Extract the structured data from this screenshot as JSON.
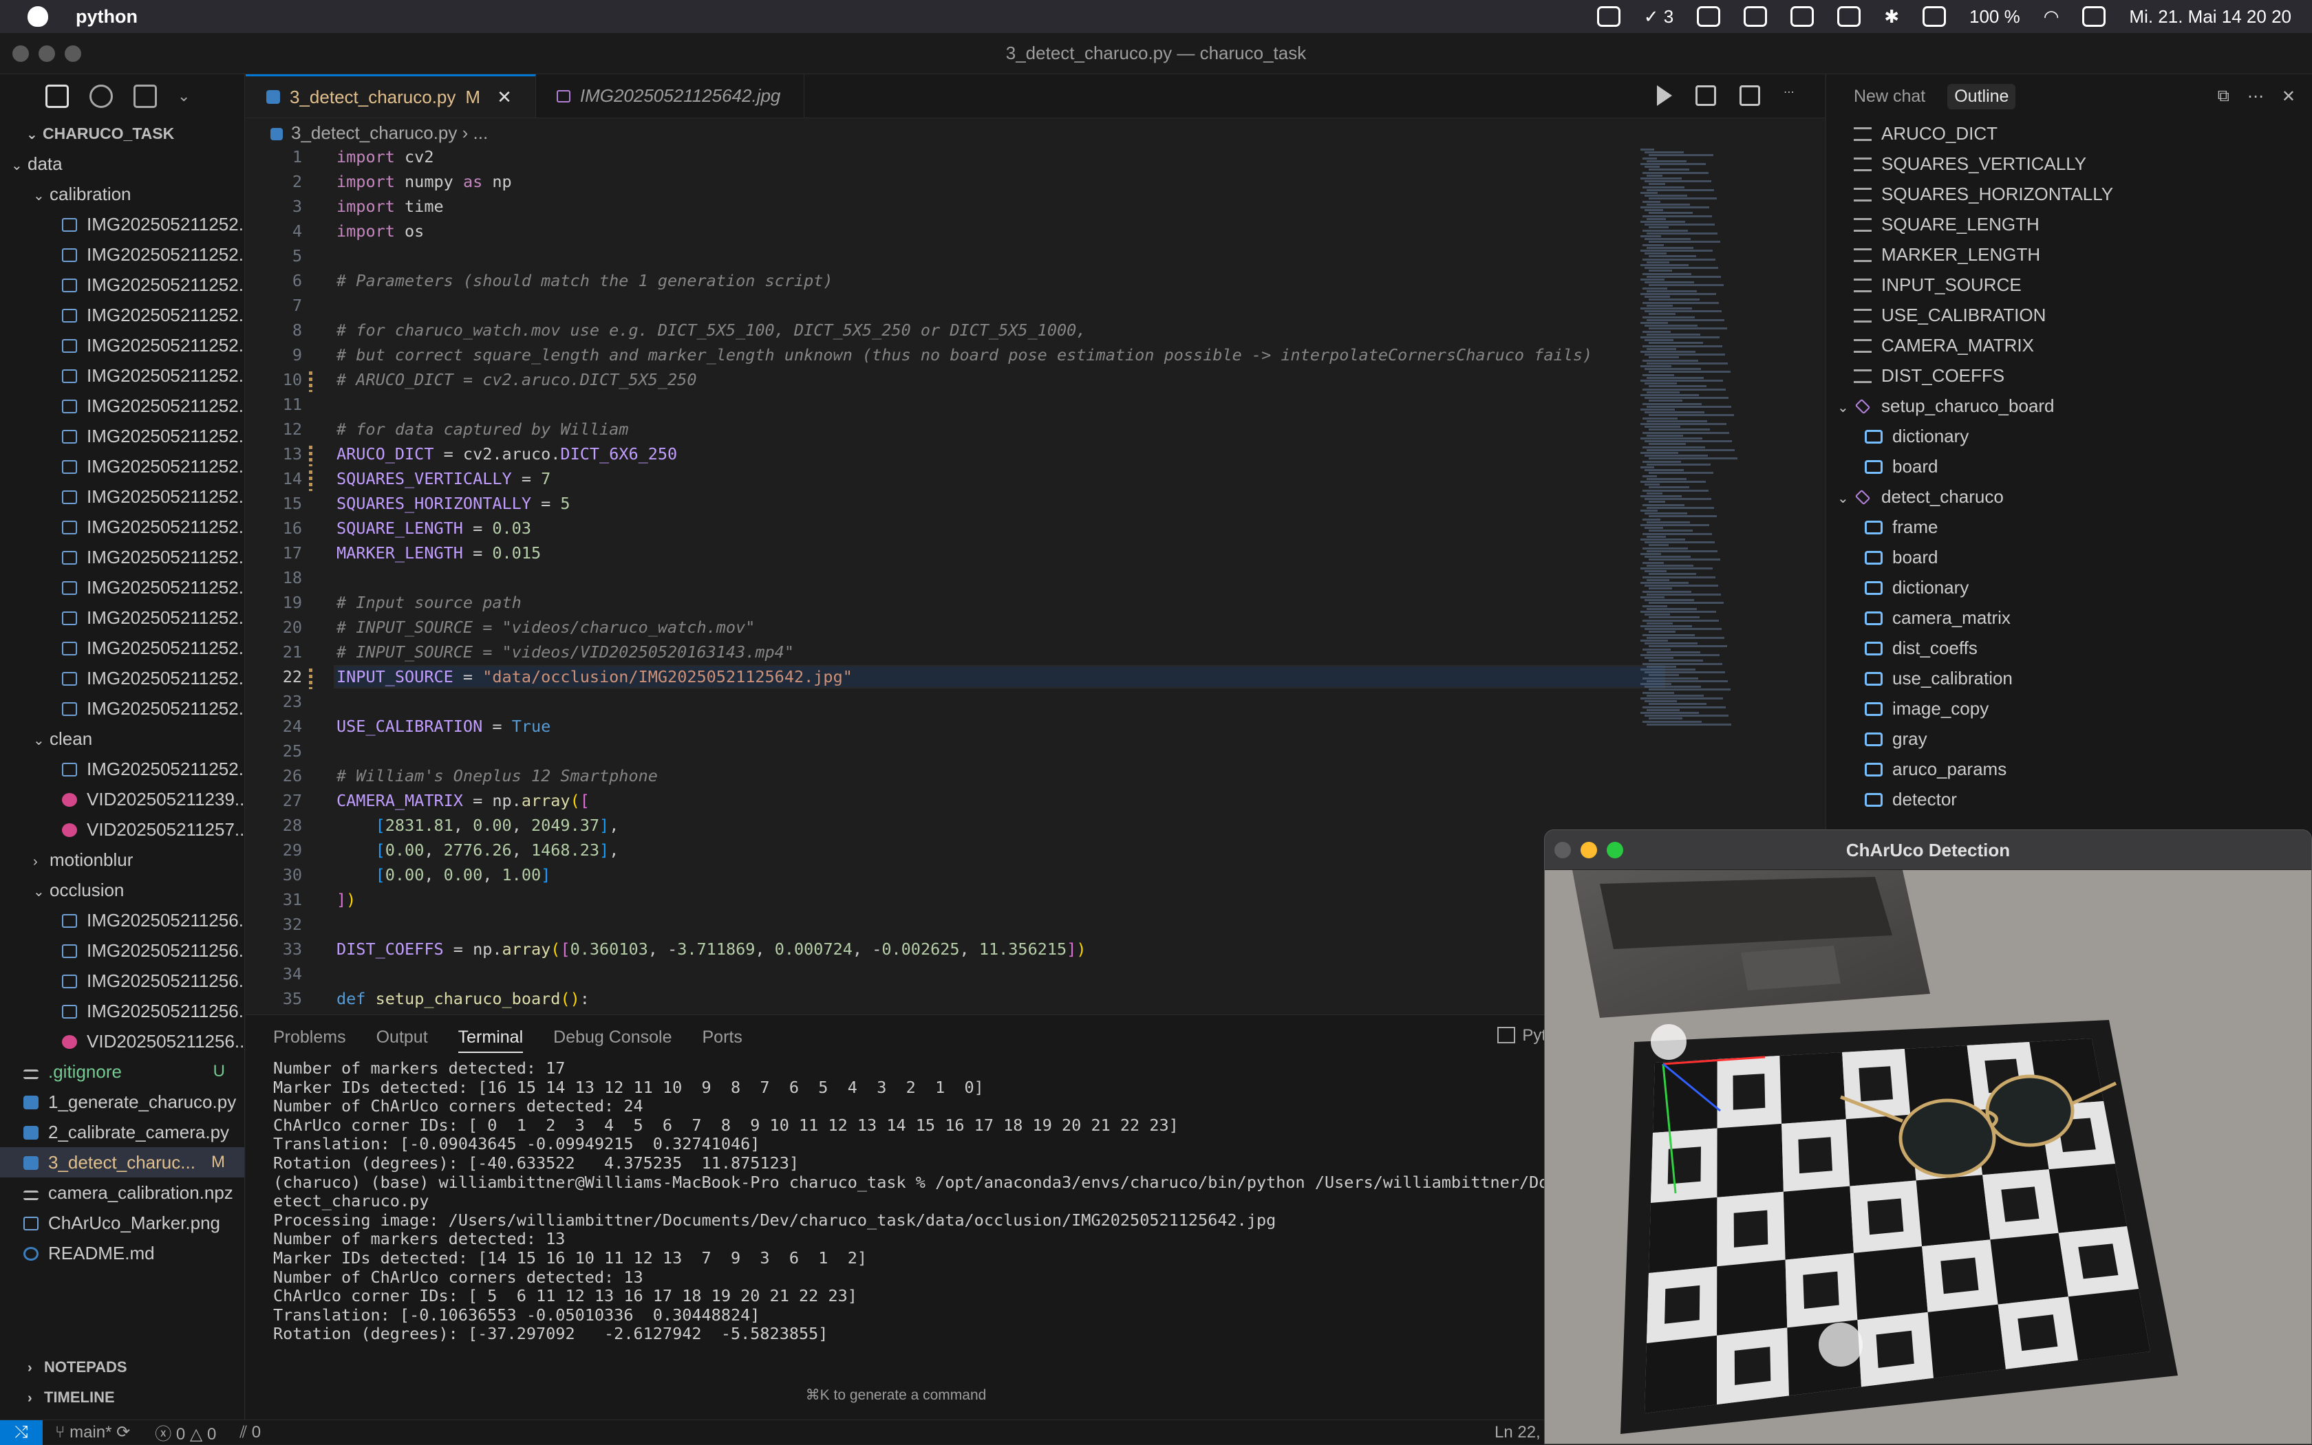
{
  "menubar": {
    "app": "python",
    "battery": "100 %",
    "badge_count": "3",
    "datetime": "Mi. 21. Mai  14 20 20"
  },
  "window": {
    "title": "3_detect_charuco.py — charuco_task"
  },
  "explorer": {
    "project": "CHARUCO_TASK",
    "rows": [
      {
        "depth": 0,
        "kind": "folder",
        "label": "data"
      },
      {
        "depth": 1,
        "kind": "folder",
        "label": "calibration"
      },
      {
        "depth": 2,
        "kind": "img",
        "label": "IMG202505211252..."
      },
      {
        "depth": 2,
        "kind": "img",
        "label": "IMG202505211252..."
      },
      {
        "depth": 2,
        "kind": "img",
        "label": "IMG202505211252..."
      },
      {
        "depth": 2,
        "kind": "img",
        "label": "IMG202505211252..."
      },
      {
        "depth": 2,
        "kind": "img",
        "label": "IMG202505211252..."
      },
      {
        "depth": 2,
        "kind": "img",
        "label": "IMG202505211252..."
      },
      {
        "depth": 2,
        "kind": "img",
        "label": "IMG202505211252..."
      },
      {
        "depth": 2,
        "kind": "img",
        "label": "IMG202505211252..."
      },
      {
        "depth": 2,
        "kind": "img",
        "label": "IMG202505211252..."
      },
      {
        "depth": 2,
        "kind": "img",
        "label": "IMG202505211252..."
      },
      {
        "depth": 2,
        "kind": "img",
        "label": "IMG202505211252..."
      },
      {
        "depth": 2,
        "kind": "img",
        "label": "IMG202505211252..."
      },
      {
        "depth": 2,
        "kind": "img",
        "label": "IMG202505211252..."
      },
      {
        "depth": 2,
        "kind": "img",
        "label": "IMG202505211252..."
      },
      {
        "depth": 2,
        "kind": "img",
        "label": "IMG202505211252..."
      },
      {
        "depth": 2,
        "kind": "img",
        "label": "IMG202505211252..."
      },
      {
        "depth": 2,
        "kind": "img",
        "label": "IMG202505211252..."
      },
      {
        "depth": 1,
        "kind": "folder",
        "label": "clean"
      },
      {
        "depth": 2,
        "kind": "img",
        "label": "IMG202505211252..."
      },
      {
        "depth": 2,
        "kind": "vid",
        "label": "VID202505211239..."
      },
      {
        "depth": 2,
        "kind": "vid",
        "label": "VID202505211257..."
      },
      {
        "depth": 1,
        "kind": "folder-closed",
        "label": "motionblur"
      },
      {
        "depth": 1,
        "kind": "folder",
        "label": "occlusion"
      },
      {
        "depth": 2,
        "kind": "img",
        "label": "IMG202505211256..."
      },
      {
        "depth": 2,
        "kind": "img",
        "label": "IMG202505211256..."
      },
      {
        "depth": 2,
        "kind": "img",
        "label": "IMG202505211256..."
      },
      {
        "depth": 2,
        "kind": "img",
        "label": "IMG202505211256..."
      },
      {
        "depth": 2,
        "kind": "vid",
        "label": "VID202505211256..."
      },
      {
        "depth": 0,
        "kind": "txt",
        "label": ".gitignore",
        "badge": "U",
        "badge_color": "#73c991",
        "color": "#73c991"
      },
      {
        "depth": 0,
        "kind": "py",
        "label": "1_generate_charuco.py"
      },
      {
        "depth": 0,
        "kind": "py",
        "label": "2_calibrate_camera.py"
      },
      {
        "depth": 0,
        "kind": "py",
        "label": "3_detect_charuc...",
        "badge": "M",
        "badge_color": "#e2c08d",
        "color": "#e2c08d",
        "selected": true
      },
      {
        "depth": 0,
        "kind": "txt",
        "label": "camera_calibration.npz"
      },
      {
        "depth": 0,
        "kind": "img",
        "label": "ChArUco_Marker.png"
      },
      {
        "depth": 0,
        "kind": "info",
        "label": "README.md"
      }
    ],
    "notepads": "NOTEPADS",
    "timeline": "TIMELINE"
  },
  "tabs": [
    {
      "label": "3_detect_charuco.py",
      "modified": "M"
    },
    {
      "label": "IMG20250521125642.jpg"
    }
  ],
  "breadcrumb": {
    "file": "3_detect_charuco.py",
    "more": "..."
  },
  "code": [
    "<span class='kw'>import</span> cv2",
    "<span class='kw'>import</span> numpy <span class='kw'>as</span> np",
    "<span class='kw'>import</span> time",
    "<span class='kw'>import</span> os",
    "",
    "<span class='cmg'># Parameters (should match the 1 generation script)</span>",
    "",
    "<span class='cmg'># for charuco_watch.mov use e.g. DICT_5X5_100, DICT_5X5_250 or DICT_5X5_1000,</span>",
    "<span class='cmg'># but correct square_length and marker_length unknown (thus no board pose estimation possible -> interpolateCornersCharuco fails)</span>",
    "<span class='cmg'># ARUCO_DICT = cv2.aruco.DICT_5X5_250</span>",
    "",
    "<span class='cmg'># for data captured by William</span>",
    "<span class='cn'>ARUCO_DICT</span> = cv2.aruco.<span class='cn'>DICT_6X6_250</span>",
    "<span class='cn'>SQUARES_VERTICALLY</span> = <span class='nm'>7</span>",
    "<span class='cn'>SQUARES_HORIZONTALLY</span> = <span class='nm'>5</span>",
    "<span class='cn'>SQUARE_LENGTH</span> = <span class='nm'>0.03</span>",
    "<span class='cn'>MARKER_LENGTH</span> = <span class='nm'>0.015</span>",
    "",
    "<span class='cmg'># Input source path</span>",
    "<span class='cmg'># INPUT_SOURCE = \"videos/charuco_watch.mov\"</span>",
    "<span class='cmg'># INPUT_SOURCE = \"videos/VID20250520163143.mp4\"</span>",
    "<span class='cn'>INPUT_SOURCE</span> = <span class='st'>\"data/occlusion/IMG20250521125642.jpg\"</span>",
    "",
    "<span class='cn'>USE_CALIBRATION</span> = <span class='kb'>True</span>",
    "",
    "<span class='cmg'># William's Oneplus 12 Smartphone</span>",
    "<span class='cn'>CAMERA_MATRIX</span> = np.<span class='fn'>array</span><span class='br'>(</span><span class='br2'>[</span>",
    "    <span class='br3'>[</span><span class='nm'>2831.81</span>, <span class='nm'>0.00</span>, <span class='nm'>2049.37</span><span class='br3'>]</span>,",
    "    <span class='br3'>[</span><span class='nm'>0.00</span>, <span class='nm'>2776.26</span>, <span class='nm'>1468.23</span><span class='br3'>]</span>,",
    "    <span class='br3'>[</span><span class='nm'>0.00</span>, <span class='nm'>0.00</span>, <span class='nm'>1.00</span><span class='br3'>]</span>",
    "<span class='br2'>]</span><span class='br'>)</span>",
    "",
    "<span class='cn'>DIST_COEFFS</span> = np.<span class='fn'>array</span><span class='br'>(</span><span class='br2'>[</span><span class='nm'>0.360103</span>, -<span class='nm'>3.711869</span>, <span class='nm'>0.000724</span>, -<span class='nm'>0.002625</span>, <span class='nm'>11.356215</span><span class='br2'>]</span><span class='br'>)</span>",
    "",
    "<span class='kb'>def</span> <span class='fn'>setup_charuco_board</span><span class='br'>()</span>:"
  ],
  "current_line": 22,
  "modified_lines": [
    10,
    13,
    14,
    22
  ],
  "panel": {
    "tabs": [
      "Problems",
      "Output",
      "Terminal",
      "Debug Console",
      "Ports"
    ],
    "active": "Terminal",
    "right_label": "Pyt",
    "lines": [
      "Number of markers detected: 17",
      "Marker IDs detected: [16 15 14 13 12 11 10  9  8  7  6  5  4  3  2  1  0]",
      "Number of ChArUco corners detected: 24",
      "ChArUco corner IDs: [ 0  1  2  3  4  5  6  7  8  9 10 11 12 13 14 15 16 17 18 19 20 21 22 23]",
      "Translation: [-0.09043645 -0.09949215  0.32741046]",
      "Rotation (degrees): [-40.633522   4.375235  11.875123]",
      "(charuco) (base) williambittner@Williams-MacBook-Pro charuco_task % /opt/anaconda3/envs/charuco/bin/python /Users/williambittner/Doc",
      "etect_charuco.py",
      "Processing image: /Users/williambittner/Documents/Dev/charuco_task/data/occlusion/IMG20250521125642.jpg",
      "Number of markers detected: 13",
      "Marker IDs detected: [14 15 16 10 11 12 13  7  9  3  6  1  2]",
      "Number of ChArUco corners detected: 13",
      "ChArUco corner IDs: [ 5  6 11 12 13 16 17 18 19 20 21 22 23]",
      "Translation: [-0.10636553 -0.05010336  0.30448824]",
      "Rotation (degrees): [-37.297092   -2.6127942  -5.5823855]"
    ],
    "hint": "⌘K to generate a command"
  },
  "aux": {
    "tabs": [
      "New chat",
      "Outline"
    ],
    "active": "Outline",
    "outline": [
      {
        "depth": 0,
        "kind": "var",
        "label": "ARUCO_DICT"
      },
      {
        "depth": 0,
        "kind": "var",
        "label": "SQUARES_VERTICALLY"
      },
      {
        "depth": 0,
        "kind": "var",
        "label": "SQUARES_HORIZONTALLY"
      },
      {
        "depth": 0,
        "kind": "var",
        "label": "SQUARE_LENGTH"
      },
      {
        "depth": 0,
        "kind": "var",
        "label": "MARKER_LENGTH"
      },
      {
        "depth": 0,
        "kind": "var",
        "label": "INPUT_SOURCE"
      },
      {
        "depth": 0,
        "kind": "var",
        "label": "USE_CALIBRATION"
      },
      {
        "depth": 0,
        "kind": "var",
        "label": "CAMERA_MATRIX"
      },
      {
        "depth": 0,
        "kind": "var",
        "label": "DIST_COEFFS"
      },
      {
        "depth": 0,
        "kind": "fn",
        "label": "setup_charuco_board",
        "chev": true
      },
      {
        "depth": 1,
        "kind": "loc",
        "label": "dictionary"
      },
      {
        "depth": 1,
        "kind": "loc",
        "label": "board"
      },
      {
        "depth": 0,
        "kind": "fn",
        "label": "detect_charuco",
        "chev": true
      },
      {
        "depth": 1,
        "kind": "loc",
        "label": "frame"
      },
      {
        "depth": 1,
        "kind": "loc",
        "label": "board"
      },
      {
        "depth": 1,
        "kind": "loc",
        "label": "dictionary"
      },
      {
        "depth": 1,
        "kind": "loc",
        "label": "camera_matrix"
      },
      {
        "depth": 1,
        "kind": "loc",
        "label": "dist_coeffs"
      },
      {
        "depth": 1,
        "kind": "loc",
        "label": "use_calibration"
      },
      {
        "depth": 1,
        "kind": "loc",
        "label": "image_copy"
      },
      {
        "depth": 1,
        "kind": "loc",
        "label": "gray"
      },
      {
        "depth": 1,
        "kind": "loc",
        "label": "aruco_params"
      },
      {
        "depth": 1,
        "kind": "loc",
        "label": "detector"
      }
    ]
  },
  "status": {
    "branch": "main*",
    "errors": "0",
    "warnings": "0",
    "ports": "0",
    "position": "Ln 22,"
  },
  "cv_window": {
    "title": "ChArUco Detection"
  }
}
